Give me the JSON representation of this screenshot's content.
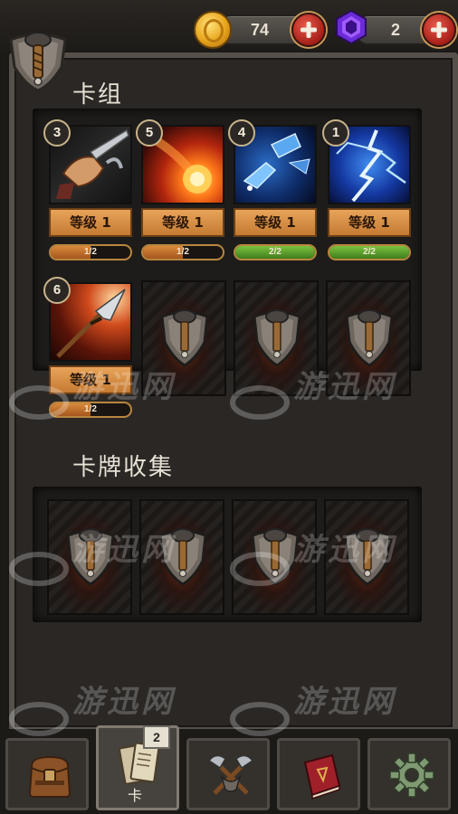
{
  "currency": {
    "coins": "74",
    "gems": "2"
  },
  "deck": {
    "title": "卡组",
    "cards": [
      {
        "cost": "3",
        "level_label": "等级 1",
        "progress_text": "1/2",
        "progress": 0.5,
        "art_icon": "fist-sword-icon"
      },
      {
        "cost": "5",
        "level_label": "等级 1",
        "progress_text": "1/2",
        "progress": 0.5,
        "art_icon": "fireball-icon"
      },
      {
        "cost": "4",
        "level_label": "等级 1",
        "progress_text": "2/2",
        "progress": 1.0,
        "art_icon": "ice-shard-icon"
      },
      {
        "cost": "1",
        "level_label": "等级 1",
        "progress_text": "2/2",
        "progress": 1.0,
        "art_icon": "lightning-icon"
      },
      {
        "cost": "6",
        "level_label": "等级 1",
        "progress_text": "1/2",
        "progress": 0.5,
        "art_icon": "spear-icon"
      }
    ]
  },
  "collection": {
    "title": "卡牌收集"
  },
  "nav": {
    "cards_label": "卡",
    "cards_badge": "2",
    "items": [
      "bag-icon",
      "cards-icon",
      "crossed-axes-icon",
      "spellbook-icon",
      "gear-icon"
    ]
  },
  "watermark": {
    "text": "游迅网"
  },
  "colors": {
    "progress_orange": "#c8722a",
    "progress_green": "#5fa02e",
    "level_orange": "#d8913f",
    "plus_red": "#c8342a"
  }
}
